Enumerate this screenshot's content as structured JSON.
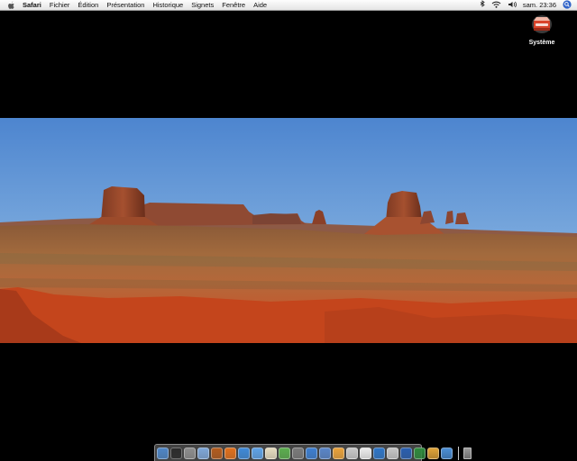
{
  "menubar": {
    "apple_icon": "apple-icon",
    "app_name": "Safari",
    "items": [
      "Fichier",
      "Édition",
      "Présentation",
      "Historique",
      "Signets",
      "Fenêtre",
      "Aide"
    ],
    "clock": "sam. 23:36",
    "status_icons": [
      "bluetooth-icon",
      "wifi-icon",
      "volume-icon",
      "spotlight-icon"
    ]
  },
  "desktop": {
    "background_color": "#000000",
    "icons": [
      {
        "label": "Système",
        "icon": "hard-drive-icon"
      }
    ],
    "wallpaper": "monument-valley-panorama"
  },
  "dock": {
    "icons": [
      {
        "name": "finder",
        "color": "#4f86c6"
      },
      {
        "name": "dashboard",
        "color": "#2c2c2c"
      },
      {
        "name": "system-preferences",
        "color": "#8e8e8e"
      },
      {
        "name": "mail",
        "color": "#7fa7d8"
      },
      {
        "name": "address-book",
        "color": "#b35c1e"
      },
      {
        "name": "firefox",
        "color": "#e0701c"
      },
      {
        "name": "safari",
        "color": "#3f8ad8"
      },
      {
        "name": "ichat",
        "color": "#5fa3e8"
      },
      {
        "name": "textedit",
        "color": "#e6dcc0"
      },
      {
        "name": "itunes",
        "color": "#5cae4f"
      },
      {
        "name": "iphoto",
        "color": "#7b7b7b"
      },
      {
        "name": "app-store",
        "color": "#3e7fd0"
      },
      {
        "name": "xcode",
        "color": "#5a86c9"
      },
      {
        "name": "pages",
        "color": "#e9a23b"
      },
      {
        "name": "preview",
        "color": "#c9c9c9"
      },
      {
        "name": "ical",
        "color": "#ececec"
      },
      {
        "name": "internet-explorer",
        "color": "#2f76c7"
      },
      {
        "name": "photo-booth",
        "color": "#c6c6c6"
      },
      {
        "name": "word",
        "color": "#2a5fb0"
      },
      {
        "name": "excel",
        "color": "#2f8a3d"
      },
      {
        "name": "garageband",
        "color": "#e0a43a"
      },
      {
        "name": "network-utility",
        "color": "#4c8fd6"
      }
    ],
    "trash_icon": "trash-icon"
  }
}
